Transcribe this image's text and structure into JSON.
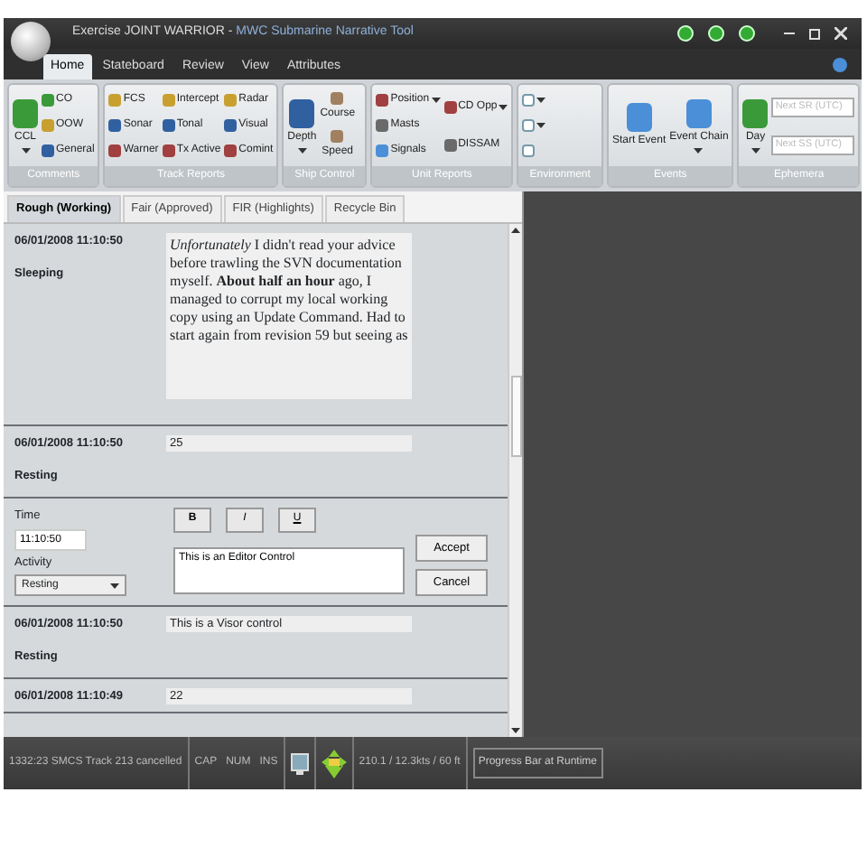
{
  "window": {
    "title": "Exercise JOINT WARRIOR -",
    "app_name": "MWC Submarine Narrative Tool"
  },
  "ribbon_tabs": [
    {
      "label": "Home",
      "selected": true
    },
    {
      "label": "Stateboard",
      "selected": false
    },
    {
      "label": "Review",
      "selected": false
    },
    {
      "label": "View",
      "selected": false
    },
    {
      "label": "Attributes",
      "selected": false
    }
  ],
  "ribbon_groups": [
    {
      "name": "Comments",
      "columns": [
        [
          {
            "kind": "large",
            "label": "CCL",
            "dropdown": true
          }
        ],
        [
          {
            "kind": "small",
            "label": "CO"
          },
          {
            "kind": "small",
            "label": "OOW"
          },
          {
            "kind": "small",
            "label": "General"
          }
        ]
      ]
    },
    {
      "name": "Track Reports",
      "columns": [
        [
          {
            "kind": "small",
            "label": "FCS"
          },
          {
            "kind": "small",
            "label": "Sonar"
          },
          {
            "kind": "small",
            "label": "Warner"
          }
        ],
        [
          {
            "kind": "small",
            "label": "Intercept"
          },
          {
            "kind": "small",
            "label": "Tonal"
          },
          {
            "kind": "small",
            "label": "Tx Active"
          }
        ],
        [
          {
            "kind": "small",
            "label": "Radar"
          },
          {
            "kind": "small",
            "label": "Visual"
          },
          {
            "kind": "small",
            "label": "Comint"
          }
        ]
      ]
    },
    {
      "name": "Ship Control",
      "columns": [
        [
          {
            "kind": "large",
            "label": "Depth",
            "dropdown": true
          }
        ],
        [
          {
            "kind": "stacked",
            "label": "Course"
          },
          {
            "kind": "stacked",
            "label": "Speed"
          }
        ]
      ]
    },
    {
      "name": "Unit Reports",
      "columns": [
        [
          {
            "kind": "small",
            "label": "Position",
            "dropdown": true
          },
          {
            "kind": "small",
            "label": "Masts"
          },
          {
            "kind": "small",
            "label": "Signals"
          }
        ],
        [
          {
            "kind": "small",
            "label": "CD Opp",
            "dropdown": true
          },
          {
            "kind": "small",
            "label": "DISSAM"
          }
        ]
      ]
    },
    {
      "name": "Environment",
      "columns": [
        [
          {
            "kind": "icon",
            "dropdown": true
          },
          {
            "kind": "icon",
            "dropdown": true
          },
          {
            "kind": "icon"
          }
        ]
      ]
    },
    {
      "name": "Events",
      "columns": [
        [
          {
            "kind": "large",
            "label": "Start Event"
          }
        ],
        [
          {
            "kind": "large",
            "label": "Event Chain",
            "dropdown": true
          }
        ]
      ]
    },
    {
      "name": "Ephemera",
      "columns": [
        [
          {
            "kind": "large",
            "label": "Day",
            "dropdown": true
          }
        ],
        [
          {
            "kind": "field",
            "placeholder": "Next SR (UTC)"
          },
          {
            "kind": "field",
            "placeholder": "Next SS (UTC)"
          }
        ]
      ]
    }
  ],
  "document_tabs": [
    {
      "label": "Rough (Working)",
      "selected": true
    },
    {
      "label": "Fair (Approved)",
      "selected": false
    },
    {
      "label": "FIR (Highlights)",
      "selected": false
    },
    {
      "label": "Recycle Bin",
      "selected": false
    }
  ],
  "entries": [
    {
      "kind": "rich",
      "timestamp": "06/01/2008 11:10:50",
      "activity": "Sleeping",
      "text": "*Unfortunately* I didn't read your advice before trawling the SVN documentation myself. **About half an hour** ago, I managed to corrupt my local working copy using an Update Command. Had to start again from revision 59 but seeing as"
    },
    {
      "kind": "visor",
      "timestamp": "06/01/2008 11:10:50",
      "activity": "Resting",
      "value": "25"
    },
    {
      "kind": "editor",
      "time_label": "Time",
      "time_value": "11:10:50",
      "activity_label": "Activity",
      "activity_value": "Resting",
      "format_buttons": [
        "B",
        "I",
        "U"
      ],
      "editor_text": "This is an Editor Control",
      "accept": "Accept",
      "cancel": "Cancel"
    },
    {
      "kind": "visor",
      "timestamp": "06/01/2008 11:10:50",
      "activity": "Resting",
      "value": "This is a Visor control"
    },
    {
      "kind": "visor",
      "timestamp": "06/01/2008 11:10:49",
      "value": "22"
    }
  ],
  "status_bar": {
    "message": "1332:23 SMCS Track 213 cancelled",
    "indicators": [
      "CAP",
      "NUM",
      "INS"
    ],
    "readout": "210.1 / 12.3kts / 60 ft",
    "progress_label": "Progress Bar at Runtime"
  }
}
